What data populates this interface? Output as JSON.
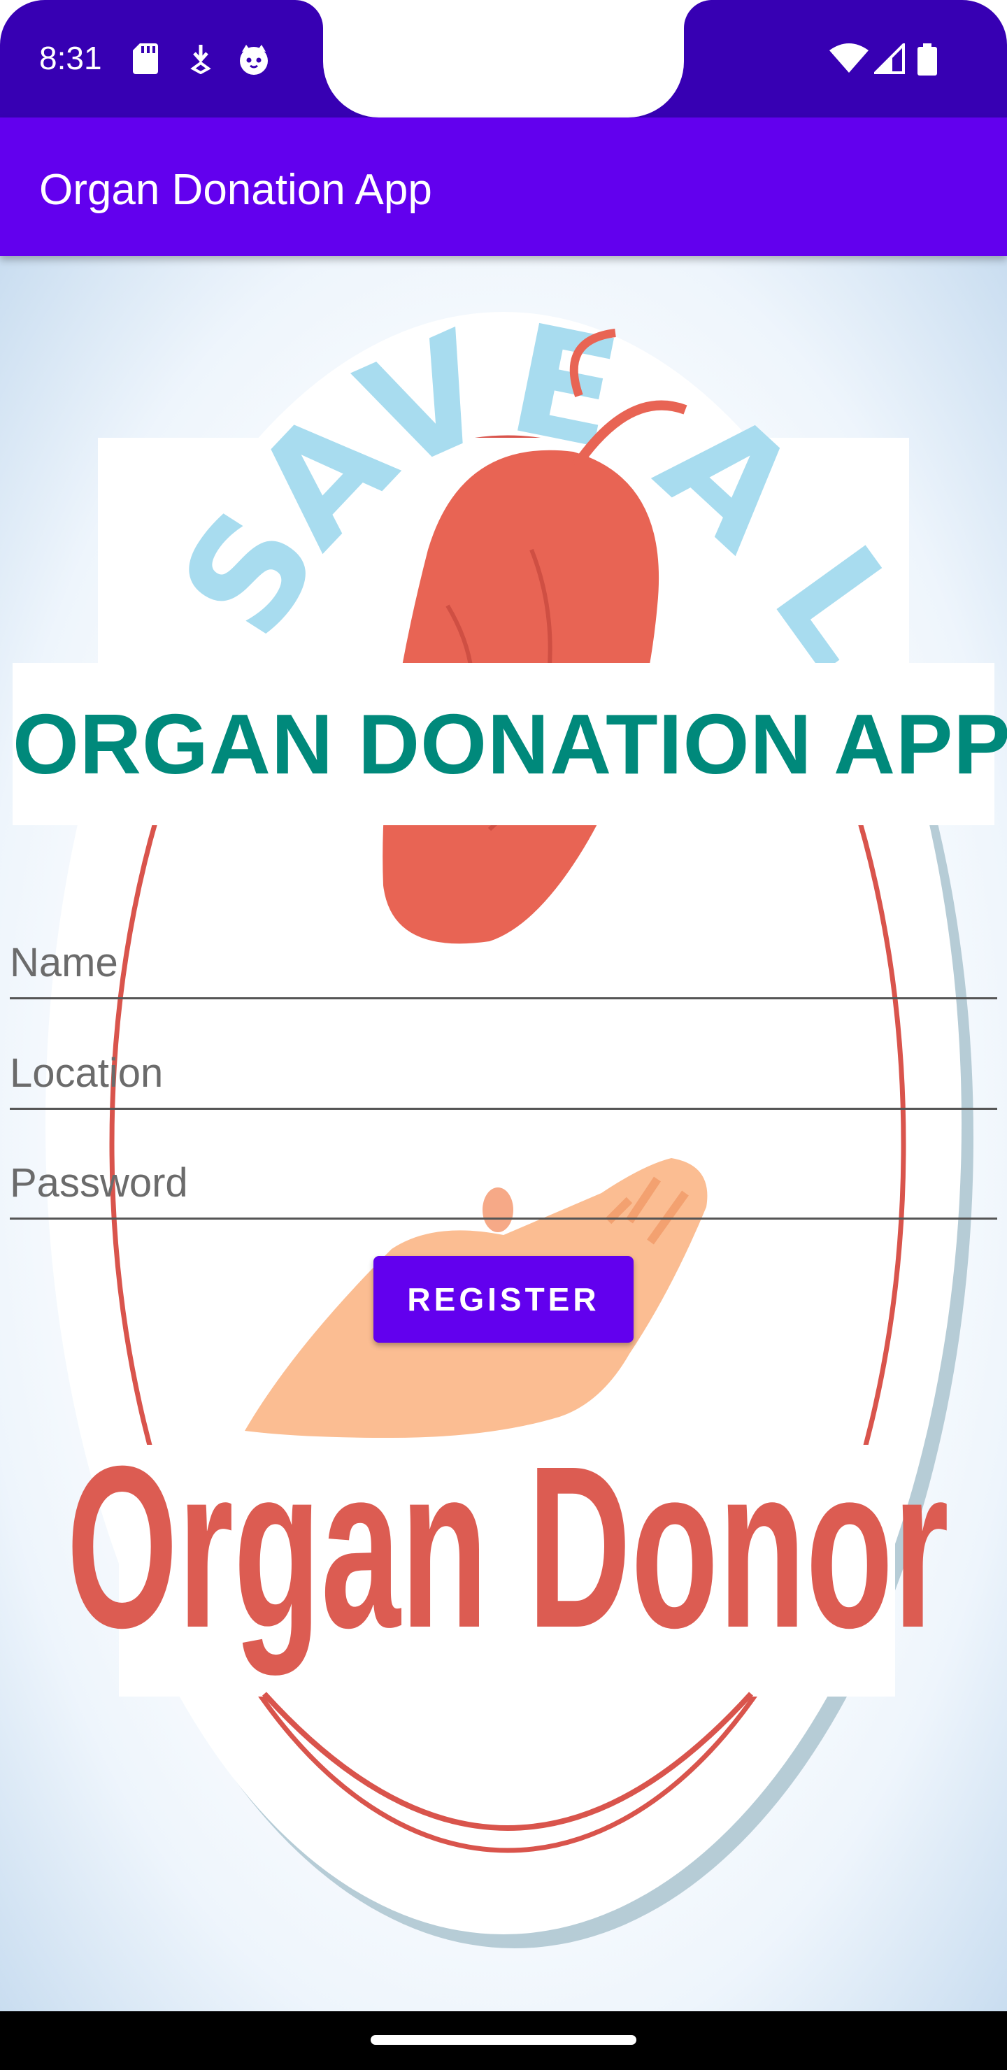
{
  "status_bar": {
    "time": "8:31",
    "left_icons": [
      "sd-card-icon",
      "download-icon",
      "cat-face-icon"
    ],
    "right_icons": [
      "wifi-icon",
      "signal-icon",
      "battery-icon"
    ]
  },
  "app_bar": {
    "title": "Organ Donation App"
  },
  "main": {
    "headline": "ORGAN DONATION APP",
    "background_art": {
      "arc_text": "SAVE A LIFE",
      "logo_text": "Organ Donor"
    },
    "fields": {
      "name_placeholder": "Name",
      "location_placeholder": "Location",
      "password_placeholder": "Password"
    },
    "register_label": "REGISTER"
  },
  "colors": {
    "status_bar": "#3700b3",
    "app_bar": "#6200ee",
    "headline": "#00897b",
    "button": "#6200ee",
    "logo_red": "#dc5c52",
    "arc_text_blue": "#a8dcef"
  }
}
